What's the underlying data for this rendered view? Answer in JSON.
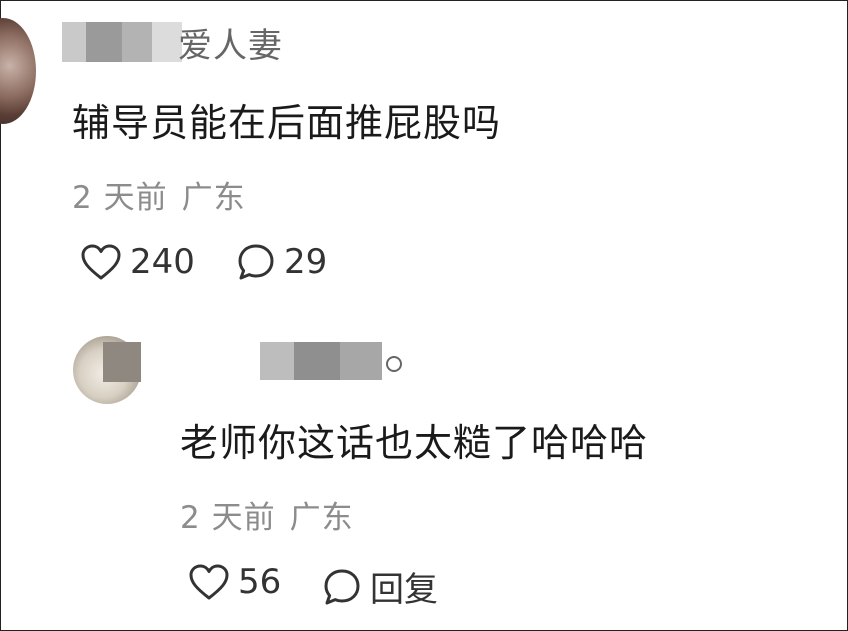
{
  "comments": [
    {
      "username_visible": "爱人妻",
      "text": "辅导员能在后面推屁股吗",
      "time": "2 天前",
      "location": "广东",
      "like_count": "240",
      "reply_count": "29"
    },
    {
      "username_visible": "",
      "text": "老师你这话也太糙了哈哈哈",
      "time": "2 天前",
      "location": "广东",
      "like_count": "56",
      "reply_label": "回复"
    }
  ],
  "icons": {
    "like": "heart-outline-icon",
    "reply": "speech-bubble-icon"
  },
  "colors": {
    "text_primary": "#1a1a1a",
    "text_meta": "#8c8c8c",
    "username": "#666666",
    "icon": "#333333"
  }
}
